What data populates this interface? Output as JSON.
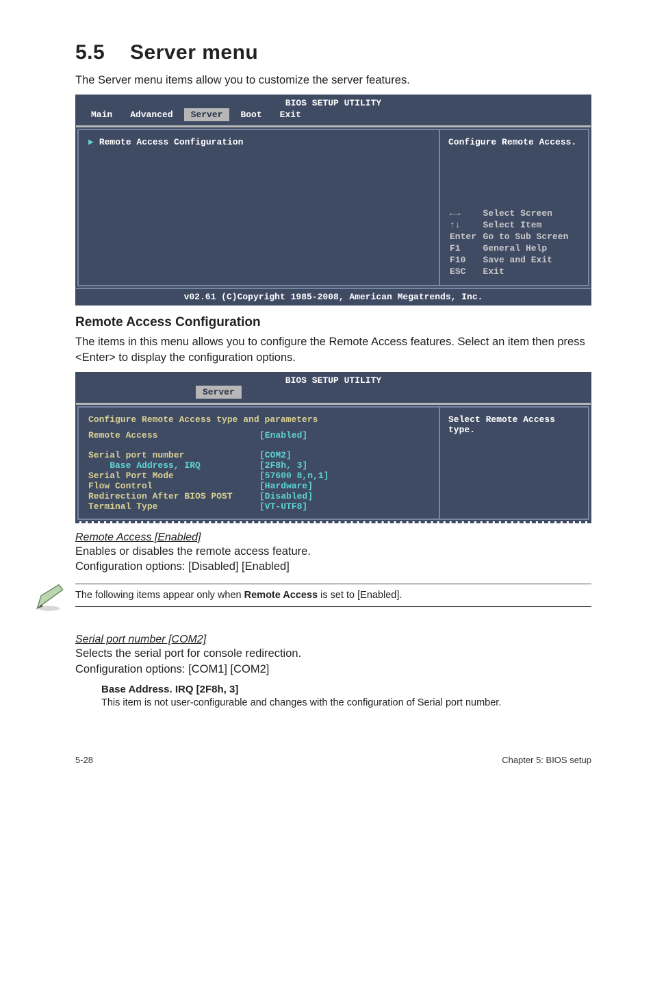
{
  "heading": {
    "num": "5.5",
    "title": "Server menu"
  },
  "intro": "The Server menu items allow you to customize the server features.",
  "bios1": {
    "title": "BIOS SETUP UTILITY",
    "tabs": [
      "Main",
      "Advanced",
      "Server",
      "Boot",
      "Exit"
    ],
    "active_tab": "Server",
    "left_item": "Remote Access Configuration",
    "right_help": "Configure Remote Access.",
    "keys": [
      {
        "k": "←→",
        "v": "Select Screen"
      },
      {
        "k": "↑↓",
        "v": "Select Item"
      },
      {
        "k": "Enter",
        "v": "Go to Sub Screen"
      },
      {
        "k": "F1",
        "v": "General Help"
      },
      {
        "k": "F10",
        "v": "Save and Exit"
      },
      {
        "k": "ESC",
        "v": "Exit"
      }
    ],
    "footer": "v02.61 (C)Copyright 1985-2008, American Megatrends, Inc."
  },
  "remote_heading": "Remote Access Configuration",
  "remote_body": "The items in this menu allows you to configure the Remote Access features. Select an item then press <Enter> to display the configuration options.",
  "bios2": {
    "title": "BIOS SETUP UTILITY",
    "active_tab": "Server",
    "header_line": "Configure Remote Access type and parameters",
    "right_help": "Select Remote Access type.",
    "fields": [
      {
        "label": "Remote Access",
        "value": "[Enabled]",
        "spaced": true
      },
      {
        "label": "Serial port number",
        "value": "[COM2]"
      },
      {
        "label": "    Base Address, IRQ",
        "value": "[2F8h, 3]",
        "blue_label": true
      },
      {
        "label": "Serial Port Mode",
        "value": "[57600 8,n,1]"
      },
      {
        "label": "Flow Control",
        "value": "[Hardware]"
      },
      {
        "label": "Redirection After BIOS POST",
        "value": "[Disabled]"
      },
      {
        "label": "Terminal Type",
        "value": "[VT-UTF8]"
      }
    ]
  },
  "settings": [
    {
      "head": "Remote Access [Enabled]",
      "lines": [
        "Enables or disables the remote access feature.",
        "Configuration options: [Disabled] [Enabled]"
      ]
    },
    {
      "head": "Serial port number [COM2]",
      "lines": [
        "Selects the serial port for console redirection.",
        "Configuration options: [COM1] [COM2]"
      ]
    }
  ],
  "note": {
    "pre": "The following items appear only when ",
    "bold": "Remote Access",
    "post": " is set to [Enabled]."
  },
  "sub_setting": {
    "head": "Base Address. IRQ [2F8h, 3]",
    "body": "This item is not user-configurable and changes with the configuration of Serial port number."
  },
  "footer": {
    "left": "5-28",
    "right": "Chapter 5: BIOS setup"
  }
}
